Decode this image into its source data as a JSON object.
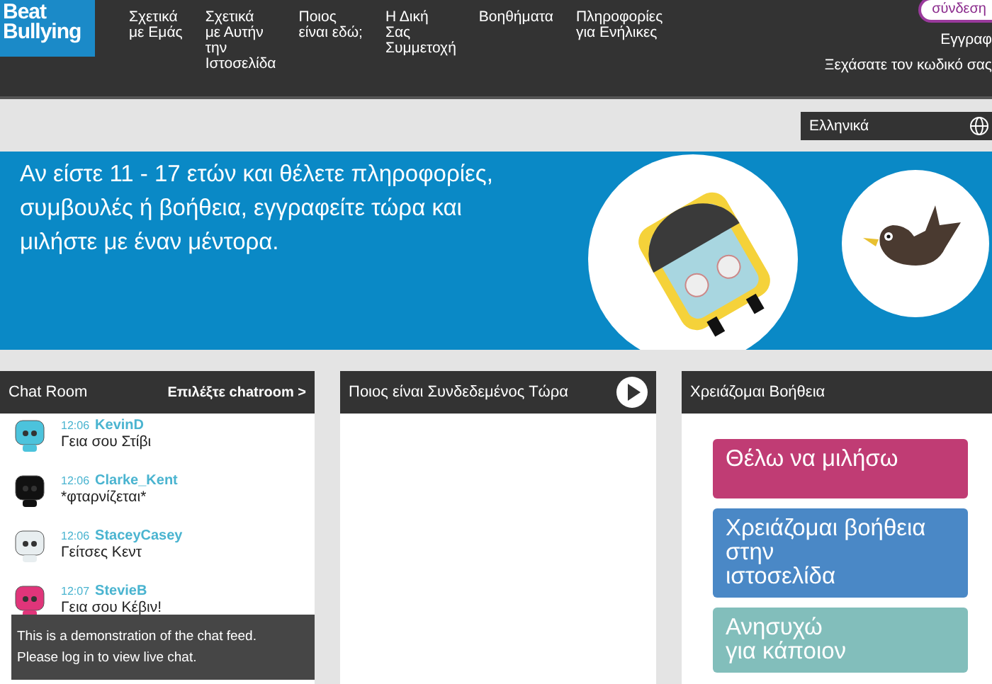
{
  "logo": {
    "line1": "Beat",
    "line2": "Bullying"
  },
  "nav": [
    {
      "label": "Σχετικά\nμε Εμάς"
    },
    {
      "label": "Σχετικά\nμε Αυτήν\nτην\nΙστοσελίδα"
    },
    {
      "label": "Ποιος\nείναι εδώ;"
    },
    {
      "label": "Η Δική\nΣας\nΣυμμετοχή"
    },
    {
      "label": "Βοηθήματα"
    },
    {
      "label": "Πληροφορίες\nγια Ενήλικες"
    }
  ],
  "account": {
    "login": "σύνδεση",
    "register": "Εγγραφ",
    "forgot": "Ξεχάσατε τον κωδικό σας"
  },
  "language": {
    "value": "Ελληνικά"
  },
  "banner": {
    "text": "Αν είστε 11 - 17 ετών και θέλετε πληροφορίες, συμβουλές ή βοήθεια, εγγραφείτε τώρα και μιλήστε με έναν μέντορα."
  },
  "chat_room": {
    "title": "Chat Room",
    "select_link": "Επιλέξτε chatroom >",
    "messages": [
      {
        "time": "12:06",
        "user": "KevinD",
        "text": "Γεια σου Στίβι",
        "color": "#4cc3dc"
      },
      {
        "time": "12:06",
        "user": "Clarke_Kent",
        "text": "*φταρνίζεται*",
        "color": "#111111"
      },
      {
        "time": "12:06",
        "user": "StaceyCasey",
        "text": "Γείτσες Κεντ",
        "color": "#e8eef0"
      },
      {
        "time": "12:07",
        "user": "StevieB",
        "text": "Γεια σου Κέβιν!",
        "color": "#e0357a"
      }
    ],
    "notice": "This is a demonstration of the chat feed.\nPlease log in to view live chat."
  },
  "online_now": {
    "title": "Ποιος είναι Συνδεδεμένος Τώρα"
  },
  "need_help": {
    "title": "Χρειάζομαι Βοήθεια",
    "buttons": [
      {
        "label": "Θέλω να μιλήσω",
        "color": "#c03c74"
      },
      {
        "label": "Χρειάζομαι βοήθεια\nστην\nιστοσελίδα",
        "color": "#4a88c6"
      },
      {
        "label": "Ανησυχώ\nγια κάποιον",
        "color": "#82bebb"
      }
    ]
  }
}
